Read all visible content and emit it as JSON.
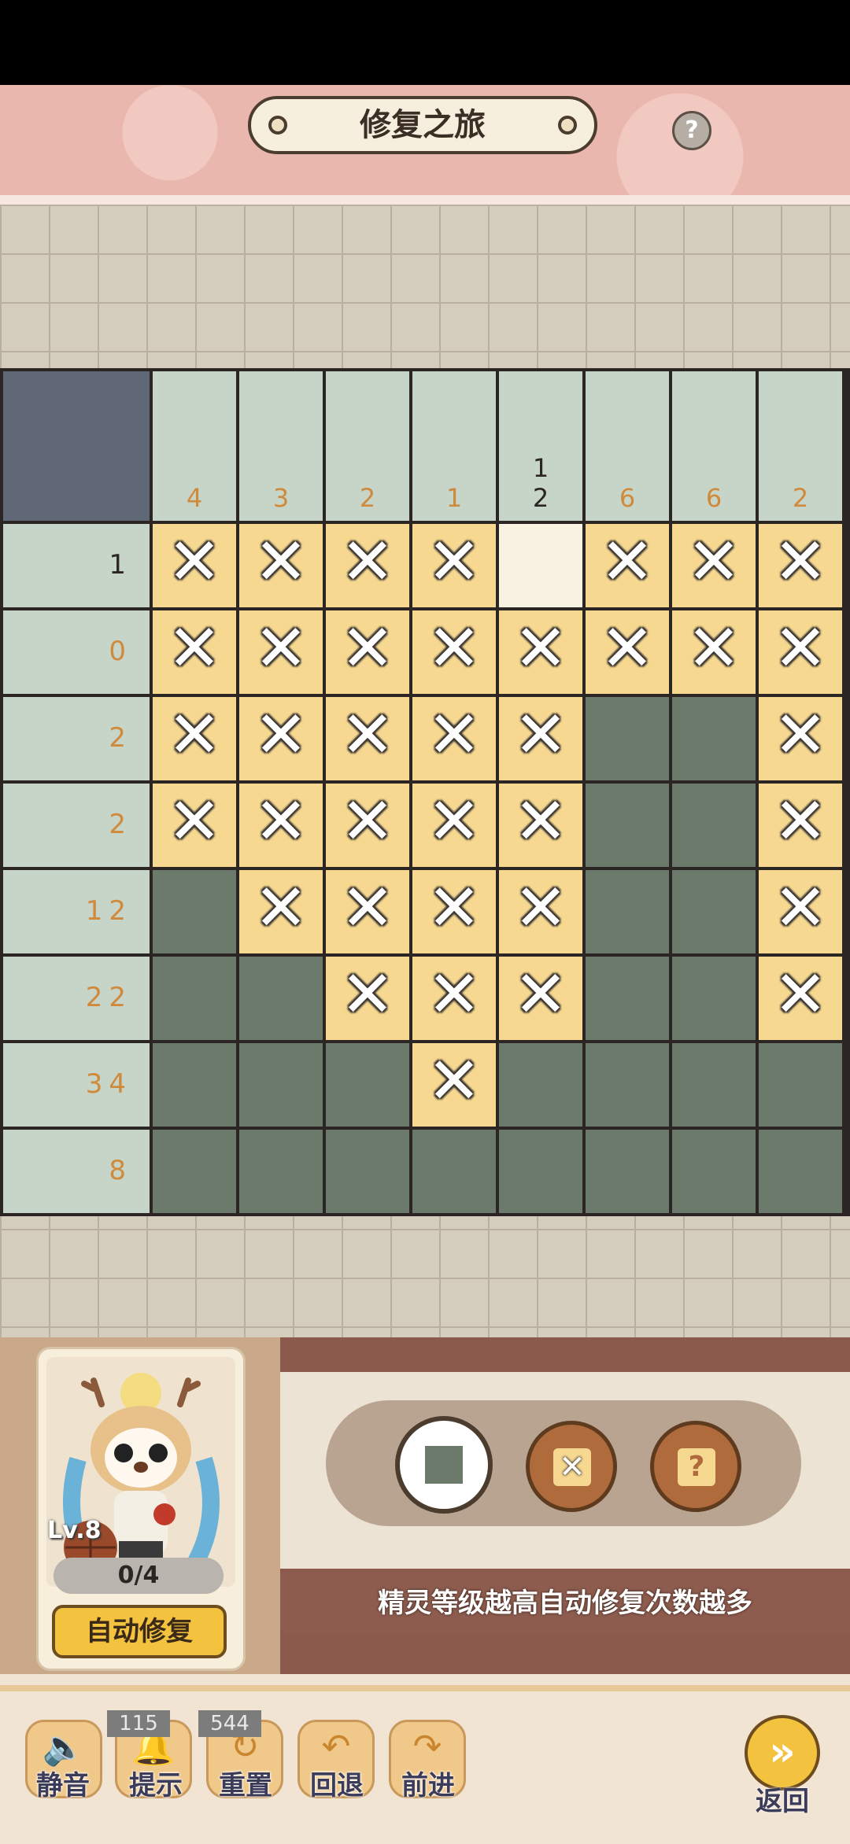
{
  "header": {
    "title": "修复之旅",
    "help_label": "?"
  },
  "board": {
    "column_clues": [
      [
        "4"
      ],
      [
        "3"
      ],
      [
        "2"
      ],
      [
        "1"
      ],
      [
        "1",
        "2"
      ],
      [
        "6"
      ],
      [
        "6"
      ],
      [
        "2"
      ]
    ],
    "row_clues": [
      "1",
      "0",
      "2",
      "2",
      "12",
      "22",
      "34",
      "8"
    ],
    "cells": [
      [
        "x",
        "x",
        "x",
        "x",
        "e",
        "x",
        "x",
        "x"
      ],
      [
        "x",
        "x",
        "x",
        "x",
        "x",
        "x",
        "x",
        "x"
      ],
      [
        "x",
        "x",
        "x",
        "x",
        "x",
        "f",
        "f",
        "x"
      ],
      [
        "x",
        "x",
        "x",
        "x",
        "x",
        "f",
        "f",
        "x"
      ],
      [
        "f",
        "x",
        "x",
        "x",
        "x",
        "f",
        "f",
        "x"
      ],
      [
        "f",
        "f",
        "x",
        "x",
        "x",
        "f",
        "f",
        "x"
      ],
      [
        "f",
        "f",
        "f",
        "x",
        "f",
        "f",
        "f",
        "f"
      ],
      [
        "f",
        "f",
        "f",
        "f",
        "f",
        "f",
        "f",
        "f"
      ]
    ],
    "legend": {
      "x": "crossed",
      "f": "filled",
      "e": "empty"
    }
  },
  "spirit": {
    "level": "Lv.8",
    "counter": "0/4",
    "auto_repair": "自动修复"
  },
  "tools": [
    {
      "name": "fill-tool"
    },
    {
      "name": "cross-tool"
    },
    {
      "name": "unknown-tool"
    }
  ],
  "tip": "精灵等级越高自动修复次数越多",
  "bottom": {
    "mute": "静音",
    "hint": "提示",
    "reset": "重置",
    "undo": "回退",
    "redo": "前进",
    "back": "返回",
    "hint_count": "115",
    "reset_count": "544"
  },
  "colors": {
    "filled": "#6b7a6a",
    "crossed": "#f6d891",
    "clue_bg": "#c7d4c8",
    "clue_text": "#d08a3c"
  }
}
